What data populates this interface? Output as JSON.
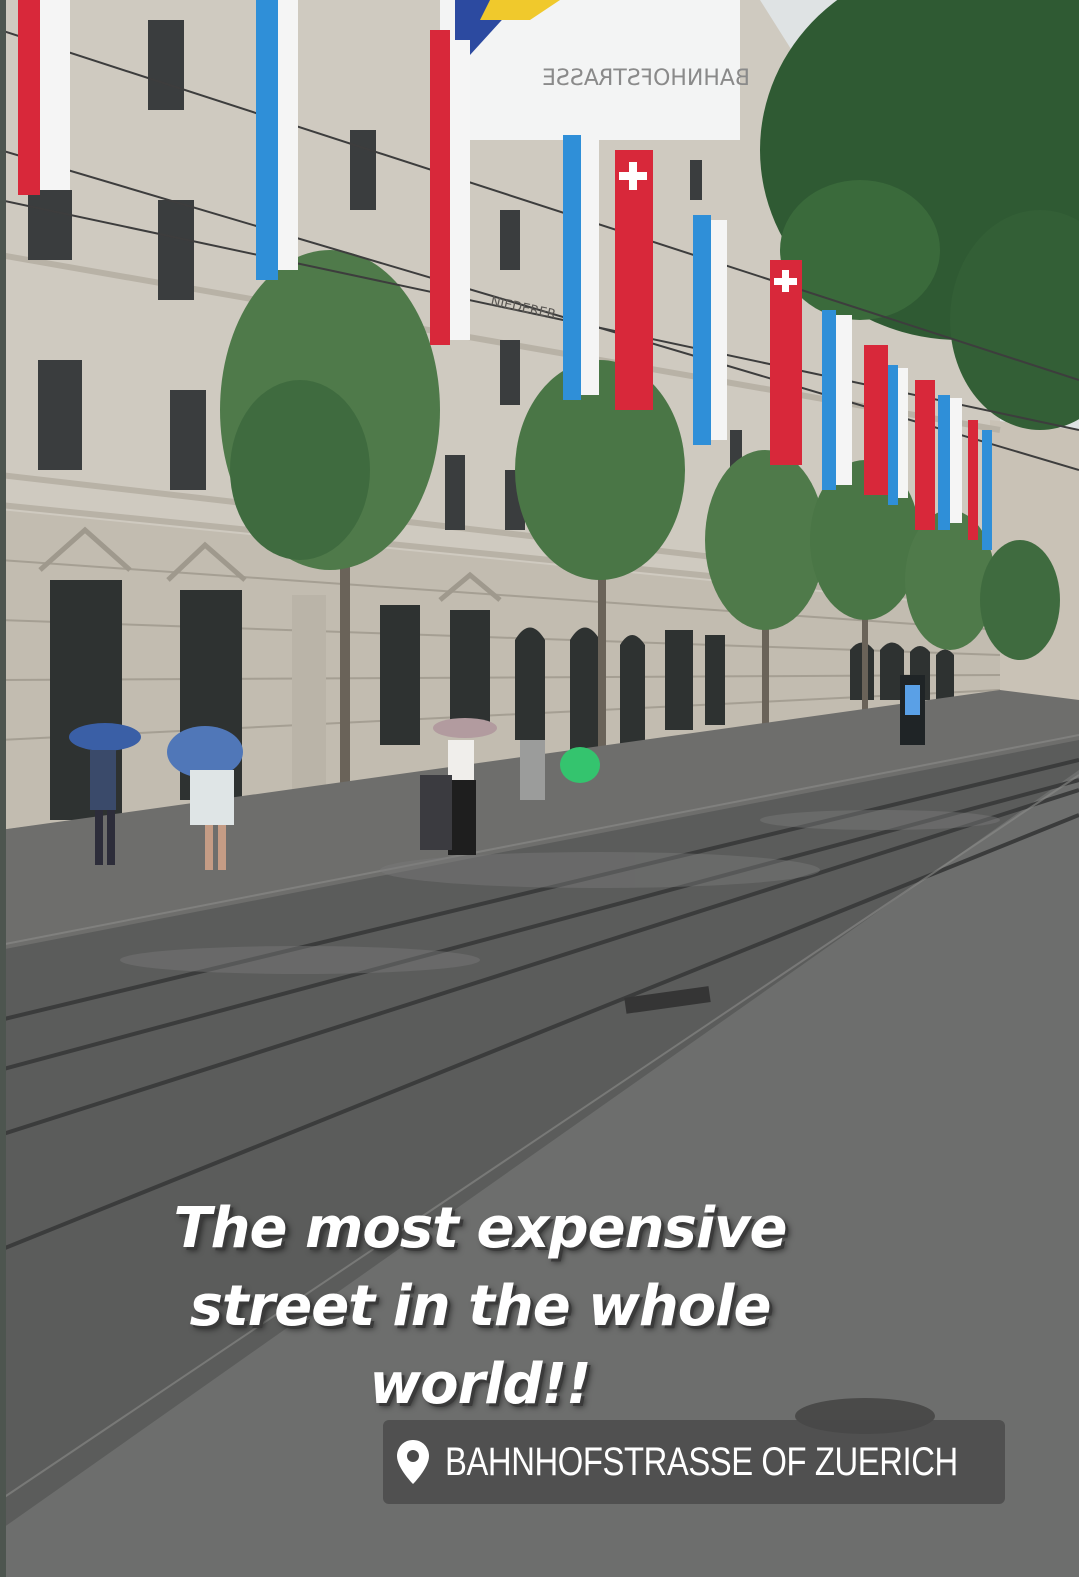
{
  "story": {
    "caption_lines": [
      "The most expensive",
      "street in the whole",
      "world!!"
    ],
    "location": {
      "icon": "location-pin-icon",
      "label": "BAHNHOFSTRASSE OF ZUERICH"
    }
  },
  "scene": {
    "banner_text": "BAHNHOFSTRASSE",
    "sign_text": "NIEDERER",
    "colors": {
      "swiss_red": "#d8283a",
      "zurich_blue": "#2f8fd8",
      "facade": "#cfcac0",
      "pavement": "#5b5c5b",
      "foliage": "#3f6b3f"
    }
  }
}
